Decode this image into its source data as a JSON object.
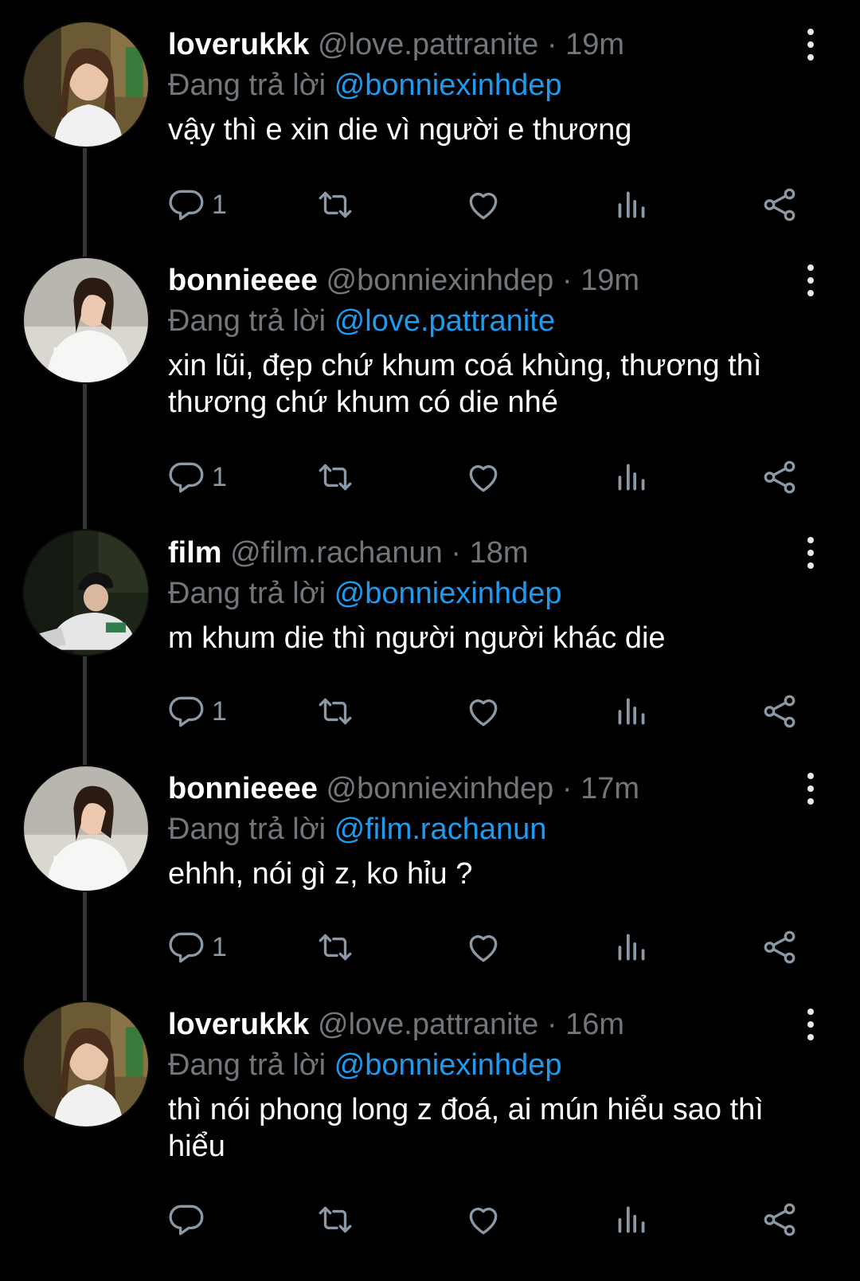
{
  "reply_prefix": "Đang trả lời",
  "separator": "·",
  "colors": {
    "background": "#000000",
    "accent": "#1d9bf0",
    "muted": "#71767b",
    "icon": "#8b98a5",
    "thread_line": "#333639"
  },
  "tweets": [
    {
      "display_name": "loverukkk",
      "handle": "@love.pattranite",
      "time": "19m",
      "reply_to": "@bonniexinhdep",
      "text": "vậy thì e xin die vì người e thương",
      "reply_count": "1",
      "avatar": "avatar-loverukkk"
    },
    {
      "display_name": "bonnieeee",
      "handle": "@bonniexinhdep",
      "time": "19m",
      "reply_to": "@love.pattranite",
      "text": "xin lũi, đẹp chứ khum coá khùng, thương thì thương chứ khum có die nhé",
      "reply_count": "1",
      "avatar": "avatar-bonnieeee"
    },
    {
      "display_name": "film",
      "handle": "@film.rachanun",
      "time": "18m",
      "reply_to": "@bonniexinhdep",
      "text": "m khum die thì người người khác die",
      "reply_count": "1",
      "avatar": "avatar-film"
    },
    {
      "display_name": "bonnieeee",
      "handle": "@bonniexinhdep",
      "time": "17m",
      "reply_to": "@film.rachanun",
      "text": "ehhh, nói gì z, ko hỉu ?",
      "reply_count": "1",
      "avatar": "avatar-bonnieeee"
    },
    {
      "display_name": "loverukkk",
      "handle": "@love.pattranite",
      "time": "16m",
      "reply_to": "@bonniexinhdep",
      "text": "thì nói phong long z đoá, ai mún hiểu sao thì hiểu",
      "reply_count": "",
      "avatar": "avatar-loverukkk"
    }
  ]
}
